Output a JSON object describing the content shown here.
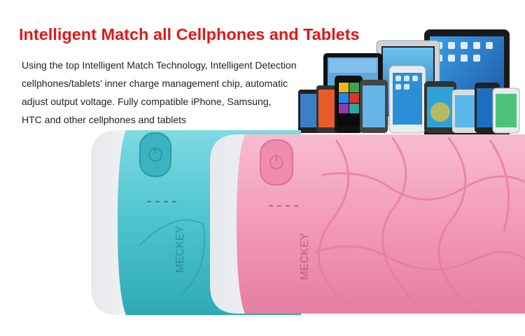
{
  "headline": "Intelligent Match all Cellphones and Tablets",
  "description_lines": [
    "Using the top Intelligent Match Technology, Intelligent Detection",
    "cellphones/tablets' inner charge management chip, automatic",
    "adjust output voltage. Fully compatible iPhone, Samsung,",
    "HTC and other cellphones and tablets"
  ],
  "brand_logo_text": "MECKEY",
  "product_colors": {
    "blue": "#4cc3cf",
    "pink": "#f39ab8",
    "cap": "#f2f4f5"
  },
  "accent_color": "#e01818",
  "device_icon": "tablets-and-phones-group"
}
